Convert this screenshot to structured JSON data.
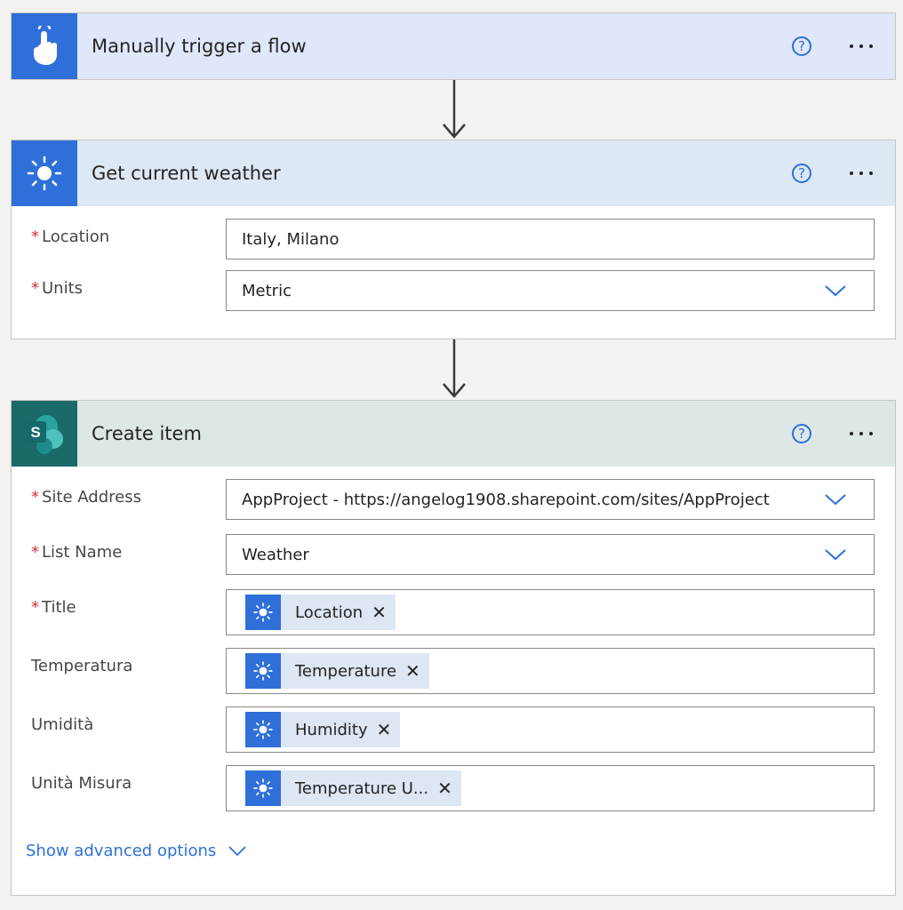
{
  "trigger": {
    "title": "Manually trigger a flow",
    "help": "?",
    "header_bg": "#dfe7fb",
    "icon_bg": "#2f6fd9",
    "icon": "hand-touch-icon"
  },
  "weather": {
    "title": "Get current weather",
    "help": "?",
    "header_bg": "#dde8f5",
    "icon_bg": "#2f6fd9",
    "icon": "sun-icon",
    "fields": {
      "location": {
        "label": "Location",
        "value": "Italy, Milano"
      },
      "units": {
        "label": "Units",
        "value": "Metric"
      }
    }
  },
  "create_item": {
    "title": "Create item",
    "help": "?",
    "header_bg": "#dde8e6",
    "icon_bg": "#1b6a6a",
    "icon": "sharepoint-icon",
    "icon_letter": "S",
    "fields": {
      "site_address": {
        "label": "Site Address",
        "value": "AppProject - https://angelog1908.sharepoint.com/sites/AppProject"
      },
      "list_name": {
        "label": "List Name",
        "value": "Weather"
      },
      "title": {
        "label": "Title",
        "token": "Location"
      },
      "temperatura": {
        "label": "Temperatura",
        "token": "Temperature"
      },
      "umidita": {
        "label": "Umidità",
        "token": "Humidity"
      },
      "unita_misura": {
        "label": "Unità Misura",
        "token": "Temperature U..."
      }
    },
    "advanced": "Show advanced options"
  },
  "required_mark": "*",
  "token_remove": "✕"
}
